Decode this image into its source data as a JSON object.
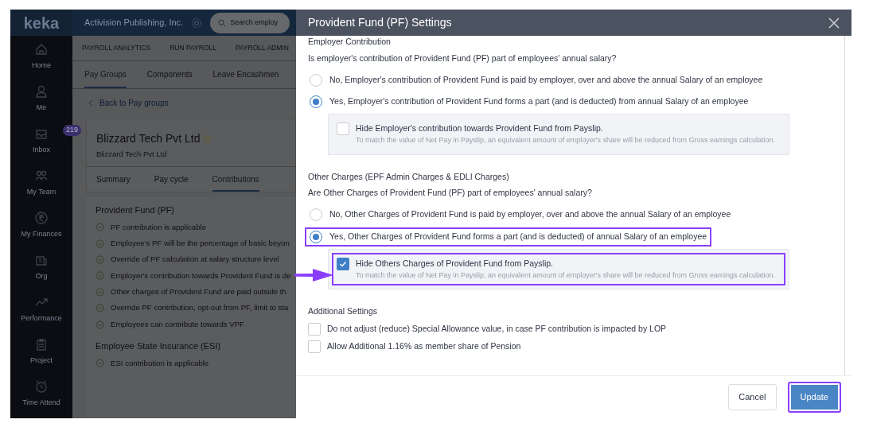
{
  "app": {
    "logo": "keka",
    "company": "Activision Publishing, Inc.",
    "search": {
      "placeholder": "Search employ"
    }
  },
  "sidebar": {
    "items": [
      {
        "label": "Home"
      },
      {
        "label": "Me"
      },
      {
        "label": "Inbox",
        "badge": "219"
      },
      {
        "label": "My Team"
      },
      {
        "label": "My Finances"
      },
      {
        "label": "Org"
      },
      {
        "label": "Performance"
      },
      {
        "label": "Project"
      },
      {
        "label": "Time Attend"
      }
    ]
  },
  "top_nav": [
    "PAYROLL ANALYTICS",
    "RUN PAYROLL",
    "PAYROLL ADMIN"
  ],
  "tabs": [
    {
      "label": "Pay Groups",
      "selected": true
    },
    {
      "label": "Components",
      "selected": false
    },
    {
      "label": "Leave Encashmen",
      "selected": false
    }
  ],
  "back_link": "Back to Pay groups",
  "pay_group": {
    "name": "Blizzard Tech Pvt Ltd",
    "subtitle": "Blizzard Tech Pvt Ltd",
    "tabs": [
      {
        "label": "Summary",
        "selected": false
      },
      {
        "label": "Pay cycle",
        "selected": false
      },
      {
        "label": "Contributions",
        "selected": true
      }
    ],
    "sections": [
      {
        "title": "Provident Fund (PF)",
        "items": [
          "PF contribution is applicable",
          "Employee's PF will be the percentage of basic beyon",
          "Override of PF calculation at salary structure level",
          "Employer's contribution towards Provident Fund is de",
          "Other charges of Provident Fund are paid outside th",
          "Override PF contribution, opt-out from PF, limit to sta",
          "Employees can contribute towards VPF"
        ]
      },
      {
        "title": "Employee State Insurance (ESI)",
        "items": [
          "ESI contribution is applicable"
        ]
      }
    ]
  },
  "modal": {
    "title": "Provident Fund (PF) Settings",
    "sections": [
      {
        "title": "Employer Contribution",
        "question": "Is employer's contribution of Provident Fund (PF) part of employees' annual salary?",
        "options": [
          {
            "label": "No, Employer's contribution of Provident Fund is paid by employer, over and above the annual Salary of an employee",
            "selected": false,
            "highlighted": false
          },
          {
            "label": "Yes, Employer's contribution of Provident Fund forms a part (and is deducted) from annual Salary of an employee",
            "selected": true,
            "highlighted": false
          }
        ],
        "sub_option": {
          "label": "Hide Employer's contribution towards Provident Fund from Payslip.",
          "hint": "To match the value of Net Pay in Payslip, an equivalent amount of employer's share will be reduced from Gross earnings calculation.",
          "checked": false,
          "highlighted": false
        }
      },
      {
        "title": "Other Charges (EPF Admin Charges & EDLI Charges)",
        "question": "Are Other Charges of Provident Fund (PF) part of employees' annual salary?",
        "options": [
          {
            "label": "No, Other Charges of Provident Fund is paid by employer, over and above the annual Salary of an employee",
            "selected": false,
            "highlighted": false
          },
          {
            "label": "Yes, Other Charges of Provident Fund forms a part (and is deducted) of annual Salary of an employee",
            "selected": true,
            "highlighted": true
          }
        ],
        "sub_option": {
          "label": "Hide Others Charges of Provident Fund from Payslip.",
          "hint": "To match the value of Net Pay in Payslip, an equivalent amount of employer's share will be reduced from Gross earnings calculation.",
          "checked": true,
          "highlighted": true
        }
      }
    ],
    "additional": {
      "title": "Additional Settings",
      "options": [
        {
          "label": "Do not adjust (reduce) Special Allowance value, in case PF contribution is impacted by LOP",
          "checked": false
        },
        {
          "label": "Allow Additional 1.16% as member share of Pension",
          "checked": false
        }
      ]
    },
    "buttons": [
      {
        "label": "Cancel",
        "kind": "secondary",
        "highlighted": false
      },
      {
        "label": "Update",
        "kind": "primary",
        "highlighted": true
      }
    ]
  }
}
